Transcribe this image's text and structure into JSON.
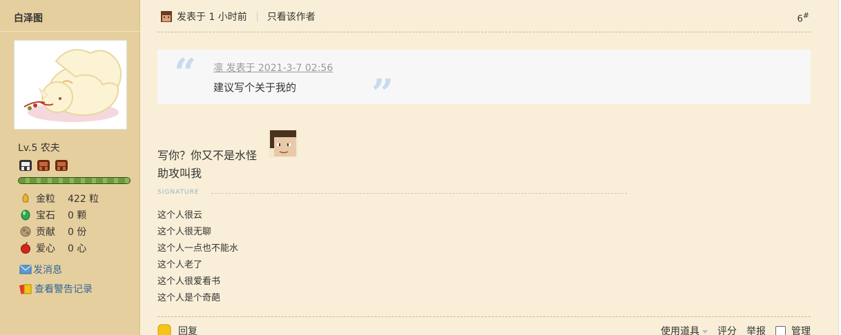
{
  "sidebar": {
    "username": "白泽图",
    "level": "Lv.5 农夫",
    "stats": [
      {
        "name": "金粒",
        "value": "422 粒",
        "icon": "gold-grain-icon"
      },
      {
        "name": "宝石",
        "value": "0 颗",
        "icon": "gem-icon"
      },
      {
        "name": "贡献",
        "value": "0 份",
        "icon": "contribution-icon"
      },
      {
        "name": "爱心",
        "value": "0 心",
        "icon": "apple-heart-icon"
      }
    ],
    "send_message": "发消息",
    "view_warnings": "查看警告记录"
  },
  "post": {
    "posted_label": "发表于 1 小时前",
    "only_author": "只看该作者",
    "floor_number": "6",
    "floor_mark": "#",
    "quote": {
      "meta": "凛 发表于 2021-3-7 02:56",
      "text": "建议写个关于我的"
    },
    "message_line1": "写你？你又不是水怪",
    "message_line2": "助攻叫我",
    "signature_label": "SIGNATURE",
    "signature_lines": [
      "这个人很云",
      "这个人很无聊",
      "这个人一点也不能水",
      "这个人老了",
      "这个人很爱看书",
      "这个人是个奇葩"
    ]
  },
  "footer": {
    "reply": "回复",
    "use_item": "使用道具",
    "rate": "评分",
    "report": "举报",
    "manage": "管理"
  }
}
